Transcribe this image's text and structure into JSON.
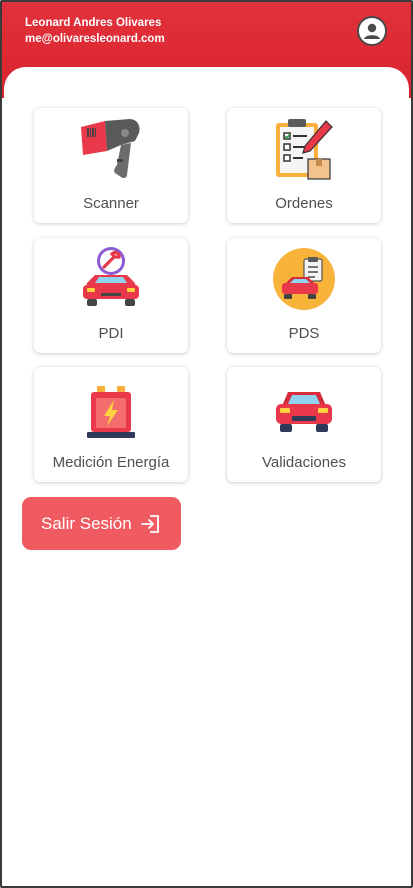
{
  "header": {
    "user_name": "Leonard Andres Olivares",
    "user_email": "me@olivaresleonard.com",
    "avatar_icon": "account-circle-icon"
  },
  "menu": {
    "items": [
      {
        "label": "Scanner",
        "icon": "barcode-scanner-icon"
      },
      {
        "label": "Ordenes",
        "icon": "clipboard-checklist-icon"
      },
      {
        "label": "PDI",
        "icon": "car-repair-icon"
      },
      {
        "label": "PDS",
        "icon": "car-document-icon"
      },
      {
        "label": "Medición Energía",
        "icon": "battery-energy-icon"
      },
      {
        "label": "Validaciones",
        "icon": "car-front-icon"
      }
    ]
  },
  "logout": {
    "label": "Salir Sesión",
    "icon": "logout-icon"
  },
  "colors": {
    "header_red": "#d8222c",
    "logout_red": "#ef5b60"
  }
}
